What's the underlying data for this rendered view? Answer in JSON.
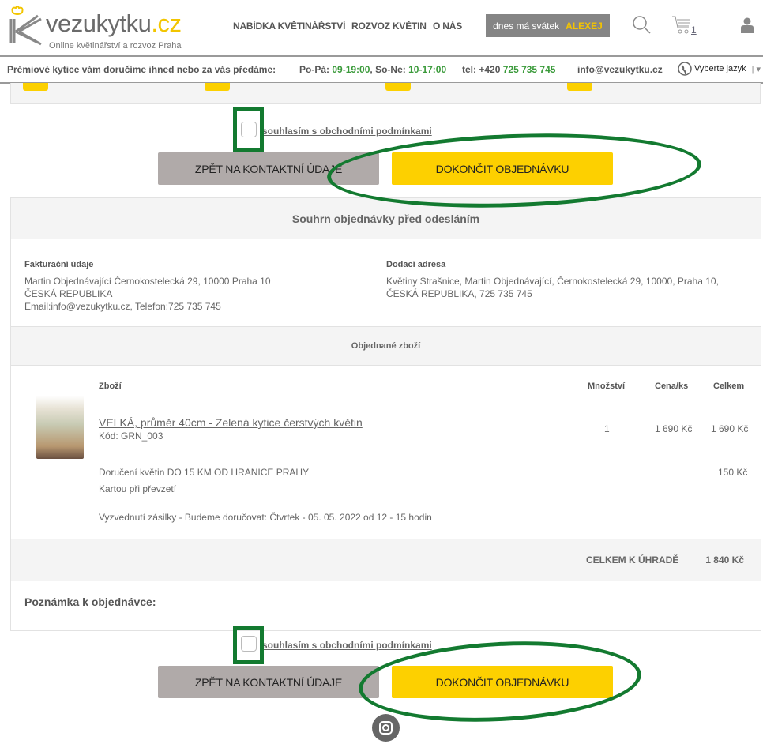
{
  "header": {
    "logo_main": "vezukytku",
    "logo_tld": ".cz",
    "logo_sub": "Online květinářství a rozvoz Praha",
    "nav": [
      "NABÍDKA KVĚTINÁŘSTVÍ",
      "ROZVOZ KVĚTIN",
      "O NÁS"
    ],
    "svatek_label": "dnes má svátek",
    "svatek_name": "ALEXEJ",
    "cart_count": "1"
  },
  "infobar": {
    "tagline": "Prémiové kytice vám doručíme ihned nebo za vás předáme:",
    "hours_wd_label": "Po-Pá:",
    "hours_wd": "09-19:00",
    "hours_we_label": ", So-Ne:",
    "hours_we": "10-17:00",
    "tel_label": "tel: +420",
    "tel": "725 735 745",
    "email": "info@vezukytku.cz",
    "language": "Vyberte jazyk"
  },
  "agree_label": "souhlasím s obchodními podmínkami",
  "buttons": {
    "back": "ZPĚT NA KONTAKTNÍ ÚDAJE",
    "finish": "DOKONČIT OBJEDNÁVKU"
  },
  "summary": {
    "title": "Souhrn objednávky před odesláním",
    "billing": {
      "label": "Fakturační údaje",
      "lines": [
        "Martin Objednávající Černokostelecká 29, 10000 Praha 10",
        "ČESKÁ REPUBLIKA",
        "Email:info@vezukytku.cz, Telefon:725 735 745"
      ]
    },
    "delivery": {
      "label": "Dodací adresa",
      "lines": [
        "Květiny Strašnice, Martin Objednávající, Černokostelecká 29, 10000, Praha 10,",
        "ČESKÁ REPUBLIKA, 725 735 745"
      ]
    },
    "items_title": "Objednané zboží",
    "columns": {
      "product": "Zboží",
      "qty": "Množství",
      "unit": "Cena/ks",
      "total": "Celkem"
    },
    "item": {
      "name": "VELKÁ, průměr 40cm - Zelená kytice čerstvých květin",
      "code": "Kód: GRN_003",
      "qty": "1",
      "unit": "1 690 Kč",
      "total": "1 690 Kč"
    },
    "delivery_fee": {
      "label": "Doručení květin DO 15 KM OD HRANICE PRAHY",
      "price": "150 Kč"
    },
    "payment": "Kartou při převzetí",
    "pickup": "Vyzvednutí zásilky - Budeme doručovat: Čtvrtek - 05. 05. 2022 od 12 - 15 hodin",
    "grand_total_label": "CELKEM K ÚHRADĚ",
    "grand_total": "1 840 Kč",
    "note_label": "Poznámka k objednávce:"
  },
  "colors": {
    "accent": "#fdd000",
    "annotation": "#137a30",
    "back_button": "#b0aaa9"
  }
}
